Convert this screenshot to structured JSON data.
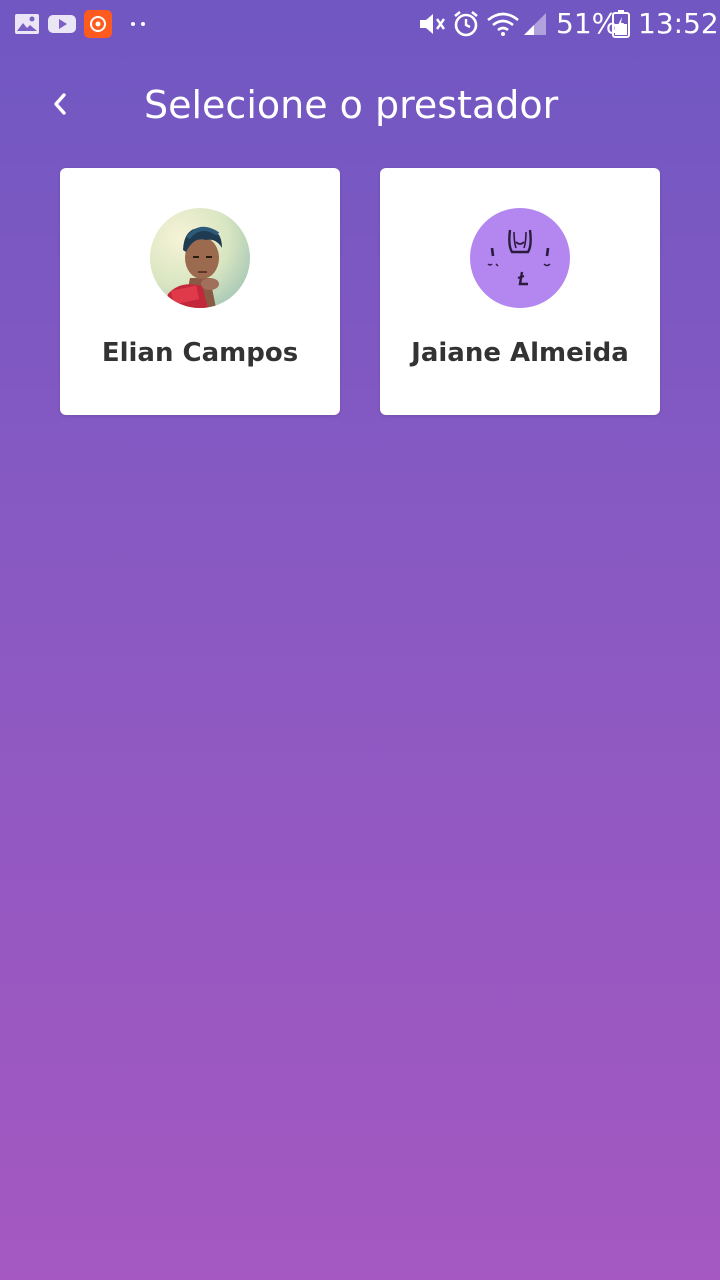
{
  "status_bar": {
    "icons": [
      "gallery-icon",
      "youtube-icon",
      "app-notification-icon",
      "more-dots-icon",
      "mute-icon",
      "alarm-icon",
      "wifi-icon",
      "signal-icon",
      "battery-icon"
    ],
    "battery_percent": "51%",
    "time": "13:52",
    "notification_color": "#ff5a1f"
  },
  "header": {
    "back_icon": "chevron-left-icon",
    "title": "Selecione o prestador"
  },
  "providers": [
    {
      "name": "Elian Campos",
      "avatar": "photo-avatar"
    },
    {
      "name": "Jaiane Almeida",
      "avatar": "illustrated-avatar",
      "avatar_bg": "#b386f0"
    }
  ],
  "colors": {
    "gradient_top": "#7057c2",
    "gradient_bottom": "#a558c1",
    "card_bg": "#ffffff",
    "name_text": "#333333"
  }
}
